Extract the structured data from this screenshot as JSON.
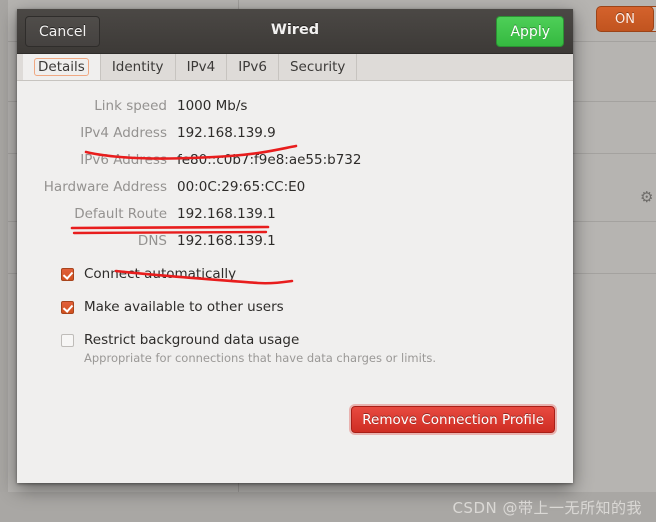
{
  "background": {
    "toggle_label": "ON",
    "gear_icon": "gear-icon"
  },
  "dialog": {
    "title": "Wired",
    "cancel_label": "Cancel",
    "apply_label": "Apply",
    "tabs": [
      {
        "label": "Details",
        "active": true
      },
      {
        "label": "Identity",
        "active": false
      },
      {
        "label": "IPv4",
        "active": false
      },
      {
        "label": "IPv6",
        "active": false
      },
      {
        "label": "Security",
        "active": false
      }
    ],
    "details": [
      {
        "label": "Link speed",
        "value": "1000 Mb/s"
      },
      {
        "label": "IPv4 Address",
        "value": "192.168.139.9"
      },
      {
        "label": "IPv6 Address",
        "value": "fe80::c0b7:f9e8:ae55:b732"
      },
      {
        "label": "Hardware Address",
        "value": "00:0C:29:65:CC:E0"
      },
      {
        "label": "Default Route",
        "value": "192.168.139.1"
      },
      {
        "label": "DNS",
        "value": "192.168.139.1"
      }
    ],
    "checkboxes": [
      {
        "label": "Connect automatically",
        "checked": true,
        "sub": ""
      },
      {
        "label": "Make available to other users",
        "checked": true,
        "sub": ""
      },
      {
        "label": "Restrict background data usage",
        "checked": false,
        "sub": "Appropriate for connections that have data charges or limits."
      }
    ],
    "remove_label": "Remove Connection Profile"
  },
  "watermark": "CSDN @带上一无所知的我",
  "colors": {
    "accent_orange": "#d1511f",
    "apply_green": "#3fbd48",
    "remove_red": "#d9362c",
    "annotation_red": "#e81d1d",
    "titlebar": "#443f3c",
    "dialog_bg": "#f0efee"
  }
}
